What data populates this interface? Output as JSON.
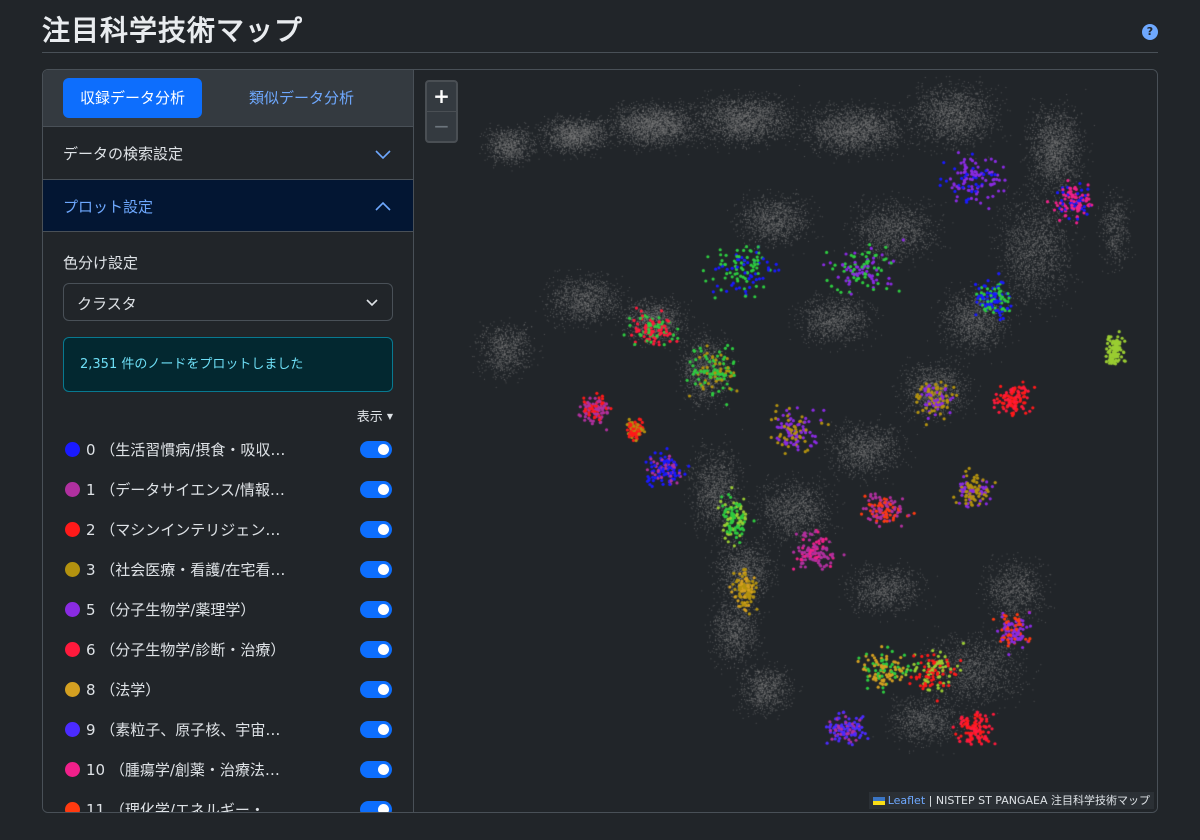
{
  "header": {
    "title": "注目科学技術マップ",
    "help_icon": "question-circle-icon",
    "help_text": "?"
  },
  "tabs": [
    {
      "label": "収録データ分析",
      "active": true
    },
    {
      "label": "類似データ分析",
      "active": false
    }
  ],
  "accordions": {
    "search": {
      "label": "データの検索設定",
      "open": false
    },
    "plot": {
      "label": "プロット設定",
      "open": true
    }
  },
  "plot_settings": {
    "color_label": "色分け設定",
    "color_select_value": "クラスタ",
    "alert": "2,351 件のノードをプロットしました",
    "show_menu": "表示"
  },
  "legend": [
    {
      "label": "0 （生活習慣病/摂食・吸収…",
      "color": "#1a1aff",
      "on": true
    },
    {
      "label": "1 （データサイエンス/情報…",
      "color": "#b0309f",
      "on": true
    },
    {
      "label": "2 （マシンインテリジェン…",
      "color": "#ff1a1a",
      "on": true
    },
    {
      "label": "3 （社会医療・看護/在宅看…",
      "color": "#b3920f",
      "on": true
    },
    {
      "label": "5 （分子生物学/薬理学）",
      "color": "#8a2be2",
      "on": true
    },
    {
      "label": "6 （分子生物学/診断・治療）",
      "color": "#ff1a3c",
      "on": true
    },
    {
      "label": "8 （法学）",
      "color": "#d4a021",
      "on": true
    },
    {
      "label": "9 （素粒子、原子核、宇宙…",
      "color": "#4b2bff",
      "on": true
    },
    {
      "label": "10 （腫瘍学/創薬・治療法…",
      "color": "#f0208a",
      "on": true
    },
    {
      "label": "11 （理化学/エネルギー・…",
      "color": "#ff3a10",
      "on": true
    }
  ],
  "map": {
    "zoom_in": "+",
    "zoom_out": "−",
    "attribution_link": "Leaflet",
    "attribution_text": " | NISTEP ST PANGAEA 注目科学技術マップ"
  }
}
